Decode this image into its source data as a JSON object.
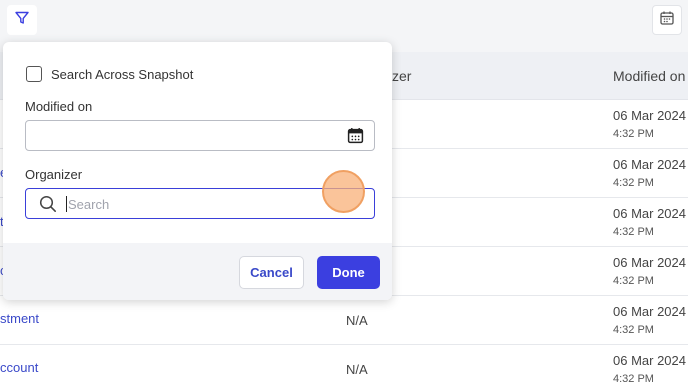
{
  "toolbar": {
    "filter_icon": "filter-icon",
    "calendar_icon": "calendar-icon"
  },
  "table": {
    "headers": {
      "organizer": "zer",
      "modified": "Modified on"
    },
    "rows": [
      {
        "name": "",
        "organizer": "",
        "date": "06 Mar 2024",
        "time": "4:32 PM"
      },
      {
        "name": "e",
        "organizer": "",
        "date": "06 Mar 2024",
        "time": "4:32 PM"
      },
      {
        "name": "t",
        "organizer": "",
        "date": "06 Mar 2024",
        "time": "4:32 PM"
      },
      {
        "name": "cl",
        "organizer": "",
        "date": "06 Mar 2024",
        "time": "4:32 PM"
      },
      {
        "name": "stment",
        "organizer": "N/A",
        "date": "06 Mar 2024",
        "time": "4:32 PM"
      },
      {
        "name": "ccount",
        "organizer": "N/A",
        "date": "06 Mar 2024",
        "time": "4:32 PM"
      }
    ]
  },
  "filter_popup": {
    "search_across_label": "Search Across Snapshot",
    "search_across_checked": false,
    "modified_on_label": "Modified on",
    "modified_on_value": "",
    "organizer_label": "Organizer",
    "organizer_placeholder": "Search",
    "cancel_label": "Cancel",
    "done_label": "Done"
  },
  "colors": {
    "accent": "#3b3fe0",
    "link": "#3a49c9"
  }
}
